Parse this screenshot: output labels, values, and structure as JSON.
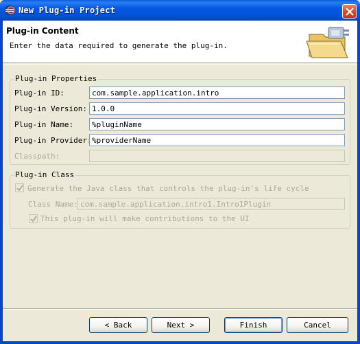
{
  "window": {
    "title": "New Plug-in Project"
  },
  "header": {
    "title": "Plug-in Content",
    "description": "Enter the data required to generate the plug-in."
  },
  "properties": {
    "group_title": "Plug-in Properties",
    "id_label": "Plug-in ID:",
    "id_value": "com.sample.application.intro",
    "version_label": "Plug-in Version:",
    "version_value": "1.0.0",
    "name_label": "Plug-in Name:",
    "name_value": "%pluginName",
    "provider_label": "Plug-in Provider:",
    "provider_value": "%providerName",
    "classpath_label": "Classpath:",
    "classpath_value": ""
  },
  "plugin_class": {
    "group_title": "Plug-in Class",
    "generate_label": "Generate the Java class that controls the plug-in's life cycle",
    "generate_checked": true,
    "class_name_label": "Class Name:",
    "class_name_value": "com.sample.application.intro1.Intro1Plugin",
    "contrib_label": "This plug-in will make contributions to the UI",
    "contrib_checked": true
  },
  "buttons": {
    "back": "< Back",
    "next": "Next >",
    "finish": "Finish",
    "cancel": "Cancel"
  },
  "icons": {
    "title": "eclipse-icon",
    "close": "close-icon",
    "wizard": "plugin-folder-icon"
  },
  "colors": {
    "titlebar": "#0458e4",
    "dialog_bg": "#ece9d8",
    "disabled_text": "#aca899"
  }
}
